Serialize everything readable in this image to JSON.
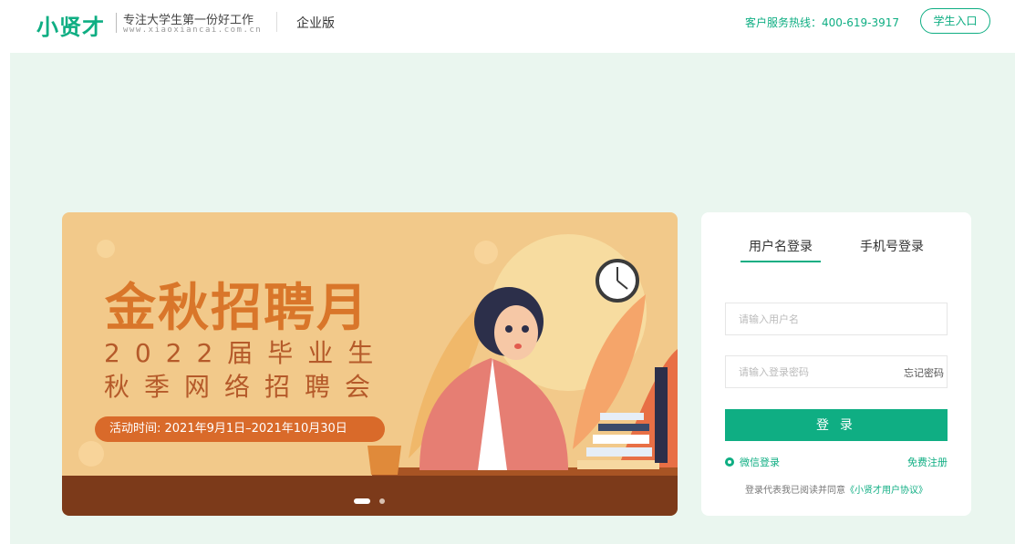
{
  "header": {
    "logo": "小贤才",
    "slogan": "专注大学生第一份好工作",
    "url": "www.xiaoxiancai.com.cn",
    "edition": "企业版",
    "hotline": "客户服务热线：400-619-3917",
    "student_entry": "学生入口"
  },
  "banner": {
    "title": "金秋招聘月",
    "line1": "2022届毕业生",
    "line2": "秋季网络招聘会",
    "date": "活动时间: 2021年9月1日–2021年10月30日"
  },
  "login": {
    "tabs": [
      "用户名登录",
      "手机号登录"
    ],
    "username_placeholder": "请输入用户名",
    "password_placeholder": "请输入登录密码",
    "forgot": "忘记密码",
    "submit": "登 录",
    "wechat": "微信登录",
    "register": "免费注册",
    "agree_prefix": "登录代表我已阅读并同意",
    "agree_link": "《小贤才用户协议》"
  },
  "colors": {
    "brand": "#0fae83",
    "banner_bg": "#f2c98a",
    "page_bg": "#eaf6ef"
  }
}
